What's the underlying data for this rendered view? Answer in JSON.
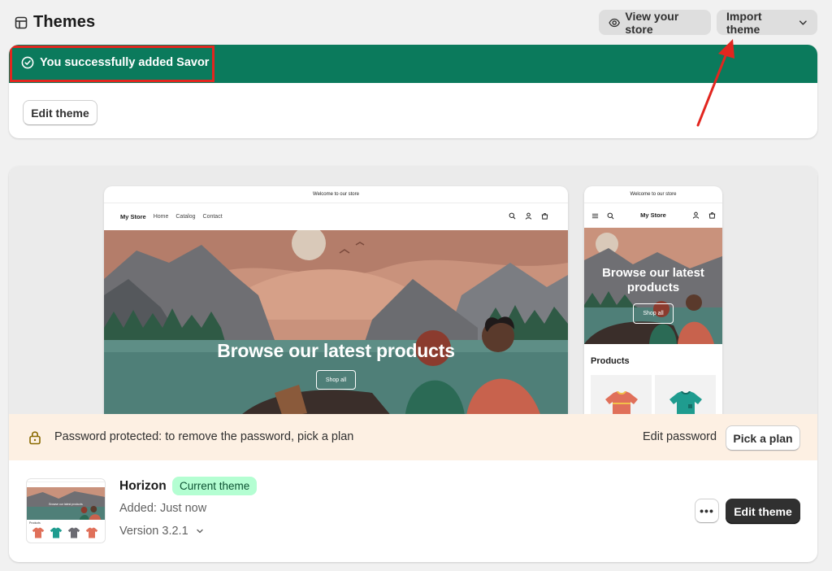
{
  "header": {
    "title": "Themes",
    "title_icon": "theme-icon",
    "view_store_label": "View your store",
    "view_store_icon": "eye-icon",
    "import_label": "Import theme",
    "import_icon": "chevron-down-icon"
  },
  "banner": {
    "message": "You successfully added Savor",
    "icon": "check-circle-icon",
    "edit_label": "Edit theme",
    "accent": "#0b7a5c",
    "highlight_color": "#e2261f"
  },
  "preview": {
    "desktop": {
      "announcement": "Welcome to our store",
      "brand": "My Store",
      "nav": [
        "Home",
        "Catalog",
        "Contact"
      ],
      "hero_title": "Browse our latest products",
      "shop_label": "Shop all"
    },
    "mobile": {
      "announcement": "Welcome to our store",
      "brand": "My Store",
      "hero_title": "Browse our latest products",
      "shop_label": "Shop all",
      "products_heading": "Products"
    }
  },
  "password": {
    "text": "Password protected: to remove the password, pick a plan",
    "edit_label": "Edit password",
    "pick_label": "Pick a plan",
    "icon": "lock-icon",
    "bg": "#fdf0e3"
  },
  "theme": {
    "name": "Horizon",
    "badge": "Current theme",
    "added": "Added: Just now",
    "version": "Version 3.2.1",
    "more_label": "•••",
    "edit_label": "Edit theme",
    "thumb_hero": "Browse our latest products",
    "thumb_products": "Products"
  }
}
